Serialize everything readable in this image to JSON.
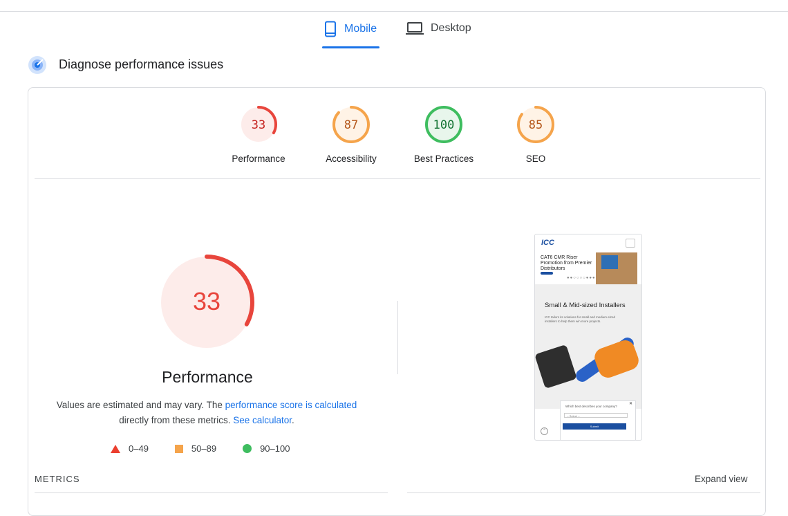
{
  "tabs": [
    {
      "label": "Mobile",
      "active": true
    },
    {
      "label": "Desktop",
      "active": false
    }
  ],
  "section": {
    "title": "Diagnose performance issues"
  },
  "scores": [
    {
      "label": "Performance",
      "value": "33",
      "score": 33,
      "color": "#e8453c",
      "bg": "#fdecea",
      "track": "#fdecea"
    },
    {
      "label": "Accessibility",
      "value": "87",
      "score": 87,
      "color": "#f5a44b",
      "bg": "#fff3e6",
      "track": "#fff3e6"
    },
    {
      "label": "Best Practices",
      "value": "100",
      "score": 100,
      "color": "#3ebd5f",
      "bg": "#e8f6ec",
      "track": "#e8f6ec"
    },
    {
      "label": "SEO",
      "value": "85",
      "score": 85,
      "color": "#f5a44b",
      "bg": "#fff3e6",
      "track": "#fff3e6"
    }
  ],
  "performance": {
    "value": "33",
    "label": "Performance",
    "desc_prefix": "Values are estimated and may vary. The ",
    "desc_link1": "performance score is calculated",
    "desc_middle": " directly from these metrics. ",
    "desc_link2": "See calculator",
    "desc_suffix": "."
  },
  "legend": [
    {
      "range": "0–49",
      "shape": "triangle",
      "color": "#eb3f2f"
    },
    {
      "range": "50–89",
      "shape": "square",
      "color": "#f5a44b"
    },
    {
      "range": "90–100",
      "shape": "circle",
      "color": "#3ebd5f"
    }
  ],
  "metrics": {
    "heading": "METRICS",
    "expand": "Expand view"
  },
  "thumbnail": {
    "logo": "ICC",
    "hero_text": "CAT6 CMR Riser Promotion from Premier Distributors",
    "heading": "Small & Mid-sized Installers",
    "paragraph": "ICC tailors its solutions for small and medium-sized installers to help them win more projects.",
    "popup_question": "Which best describes your company?",
    "popup_select": "-- Select --",
    "popup_button": "Submit",
    "popup_close": "✕"
  }
}
